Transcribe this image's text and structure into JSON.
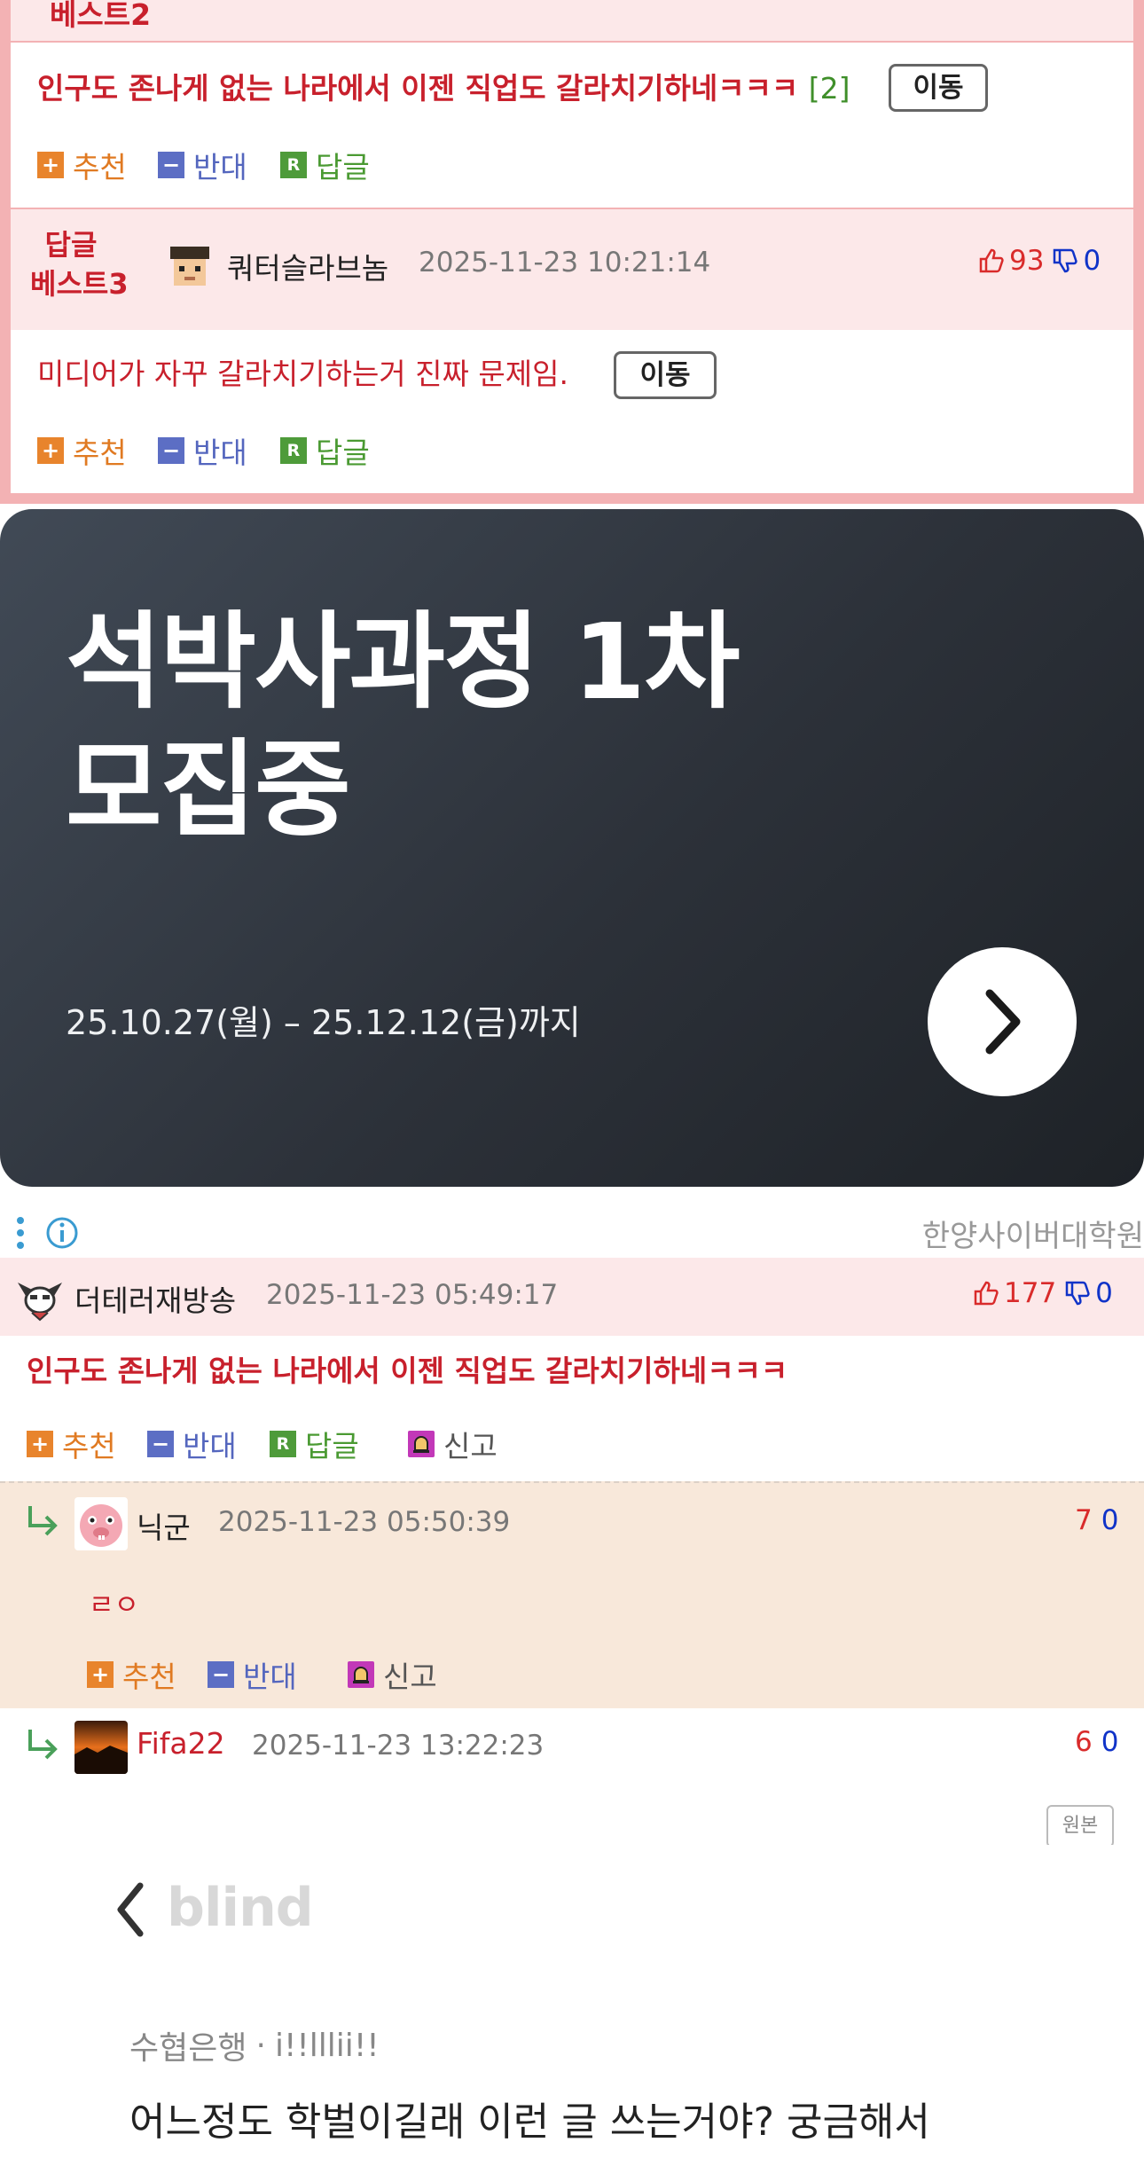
{
  "best_section": {
    "top_label_partial": "베스트2",
    "best2": {
      "text": "인구도 존나게 없는 나라에서 이젠 직업도 갈라치기하네ㅋㅋㅋ",
      "reply_count": "[2]",
      "move_label": "이동"
    },
    "best3": {
      "label_line1": "답글",
      "label_line2": "베스트3",
      "nickname": "쿼터슬라브놈",
      "date": "2025-11-23 10:21:14",
      "up": "93",
      "down": "0",
      "text": "미디어가 자꾸 갈라치기하는거 진짜 문제임.",
      "move_label": "이동"
    },
    "actions": {
      "recommend": "추천",
      "oppose": "반대",
      "reply": "답글"
    }
  },
  "ad": {
    "title": "석박사과정 1차\n모집중",
    "subtitle": "25.10.27(월) – 25.12.12(금)까지",
    "advertiser": "한양사이버대학원",
    "info_icon": "info-icon",
    "colors": {
      "banner_dark": "#2c3139",
      "text": "#ffffff"
    }
  },
  "comments": [
    {
      "nickname": "더테러재방송",
      "date": "2025-11-23 05:49:17",
      "up": "177",
      "down": "0",
      "text": "인구도 존나게 없는 나라에서 이젠 직업도 갈라치기하네ㅋㅋㅋ",
      "actions": {
        "recommend": "추천",
        "oppose": "반대",
        "reply": "답글",
        "report": "신고"
      }
    },
    {
      "nickname": "닉군",
      "date": "2025-11-23 05:50:39",
      "up": "7",
      "down": "0",
      "text": "ㄹㅇ",
      "actions": {
        "recommend": "추천",
        "oppose": "반대",
        "report": "신고"
      }
    },
    {
      "nickname": "Fifa22",
      "date": "2025-11-23 13:22:23",
      "up": "6",
      "down": "0",
      "original_label": "원본",
      "image": {
        "app_name": "blind",
        "company": "수협은행",
        "user_id": "i!!lllii!!",
        "headline": "어느정도 학벌이길래 이런 글 쓰는거야? 궁금해서"
      }
    }
  ],
  "colors": {
    "best_border": "#f3b2b4",
    "best_bg": "#fce8e9",
    "best_text": "#c8202c",
    "reply_bg": "#f8e8da",
    "up": "#d92b2b",
    "down": "#1033c8"
  }
}
